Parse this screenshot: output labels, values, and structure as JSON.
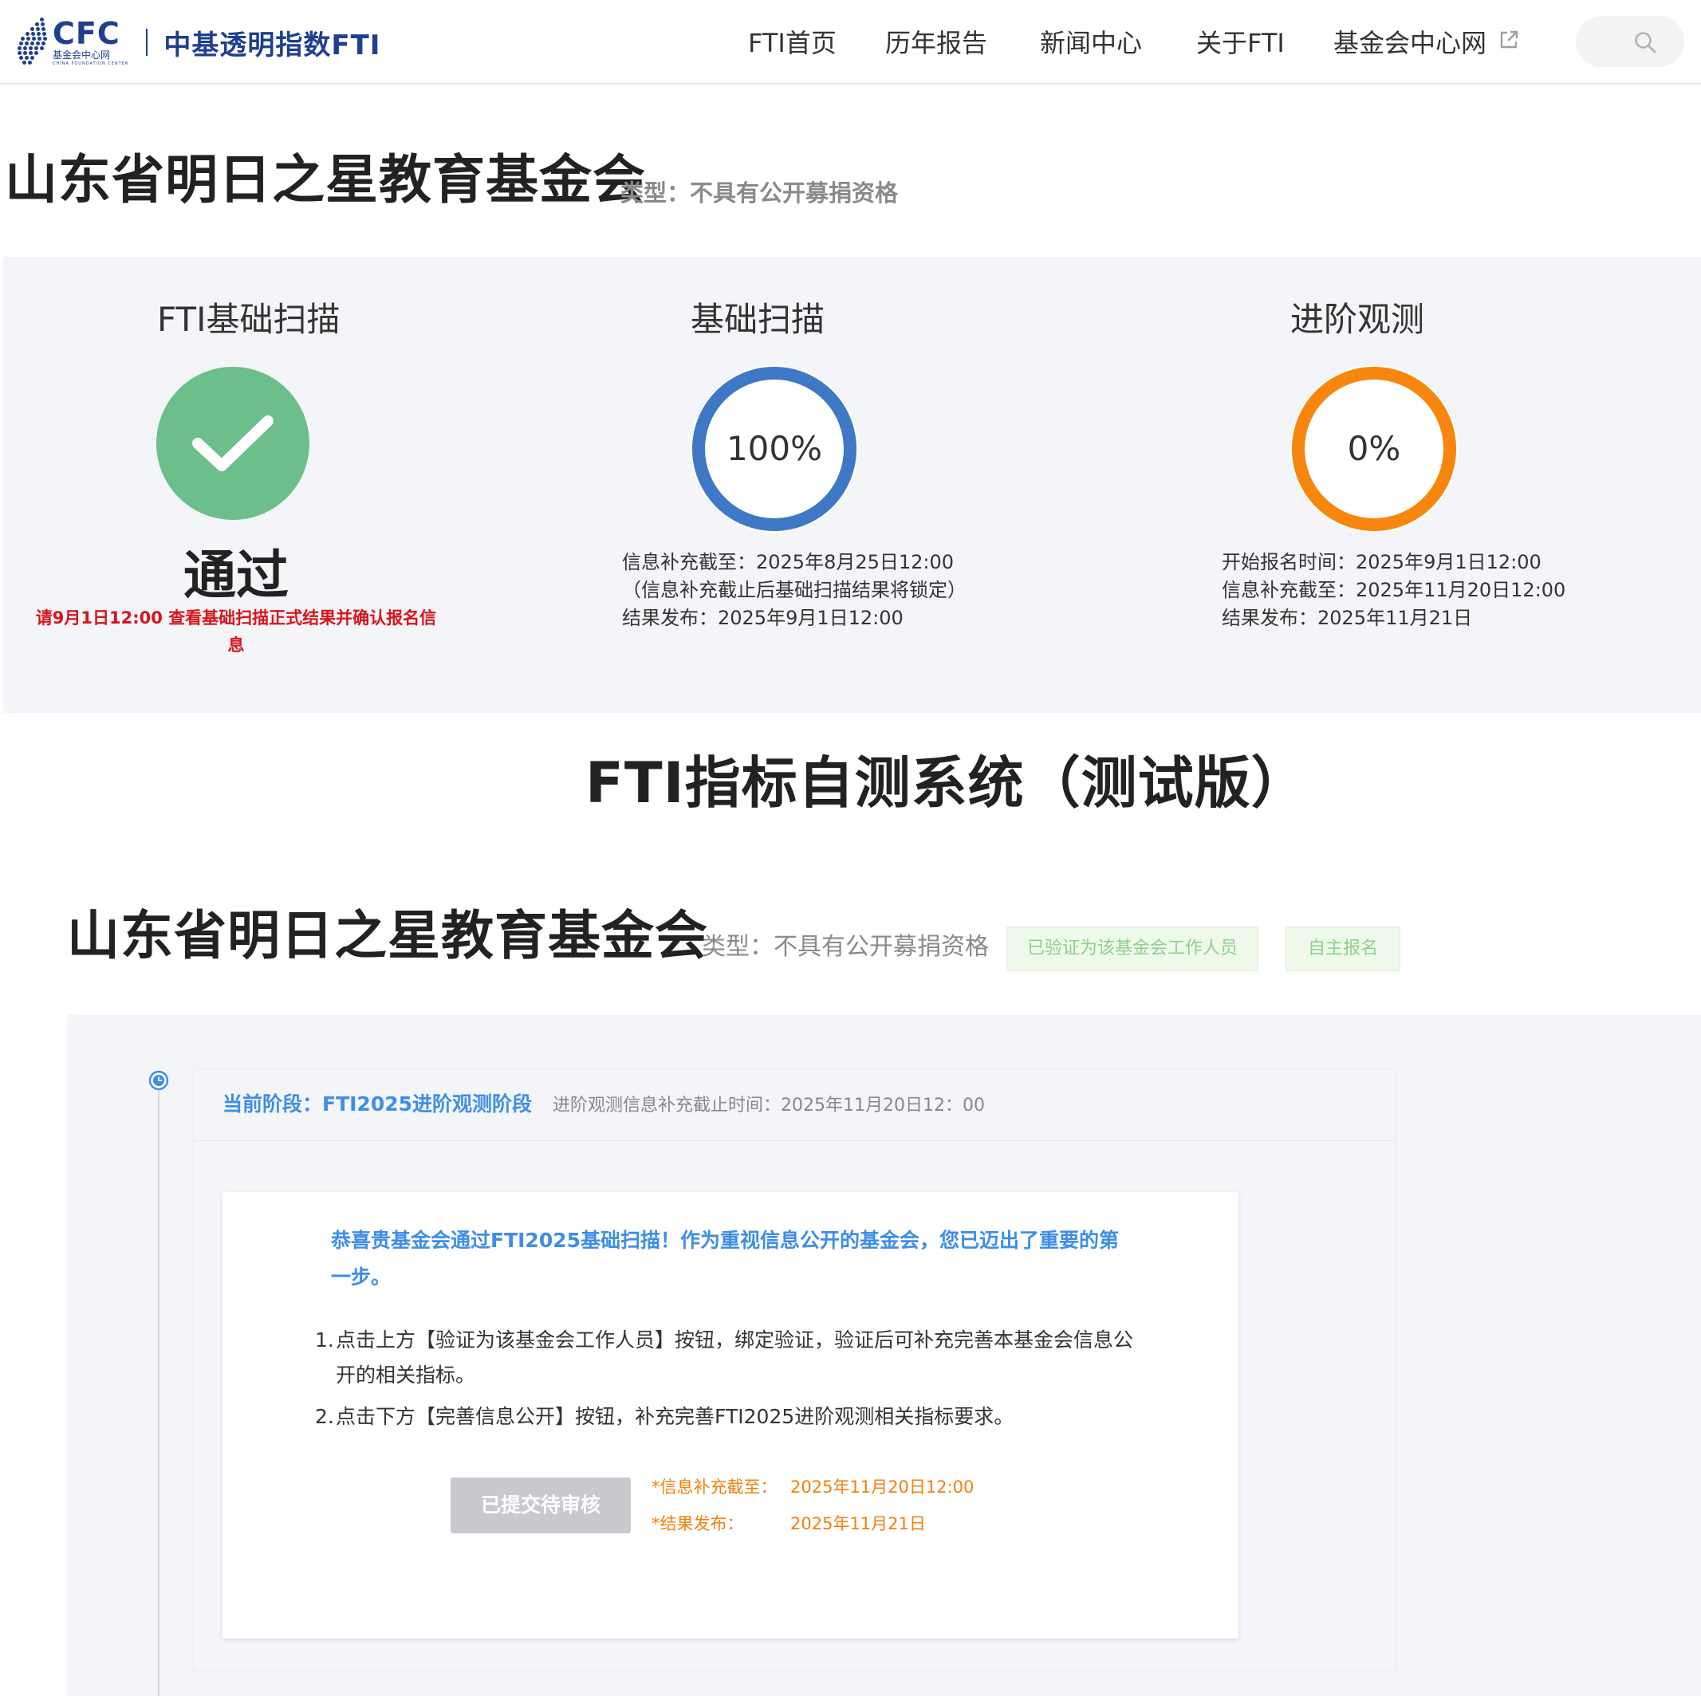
{
  "header": {
    "logo_cfc": "CFC",
    "logo_cfc_sub": "基金会中心网",
    "logo_cfc_sub2": "CHINA FOUNDATION CENTER",
    "logo_title": "中基透明指数FTI",
    "nav": [
      "FTI首页",
      "历年报告",
      "新闻中心",
      "关于FTI",
      "基金会中心网"
    ]
  },
  "page": {
    "title": "山东省明日之星教育基金会",
    "type": "类型：不具有公开募捐资格"
  },
  "scan": {
    "fti_basic": {
      "title": "FTI基础扫描",
      "status": "通过",
      "note": "请9月1日12:00 查看基础扫描正式结果并确认报名信息"
    },
    "basic": {
      "title": "基础扫描",
      "percent_label": "100%",
      "progress": 100,
      "lines": [
        "信息补充截至：2025年8月25日12:00",
        "（信息补充截止后基础扫描结果将锁定）",
        "结果发布：2025年9月1日12:00"
      ]
    },
    "advanced": {
      "title": "进阶观测",
      "percent_label": "0%",
      "progress": 0,
      "lines": [
        "开始报名时间：2025年9月1日12:00",
        "信息补充截至：2025年11月20日12:00",
        "结果发布：2025年11月21日"
      ]
    }
  },
  "system": {
    "title": "FTI指标自测系统（测试版）",
    "org_name": "山东省明日之星教育基金会",
    "org_type": "类型：不具有公开募捐资格",
    "tags": [
      "已验证为该基金会工作人员",
      "自主报名"
    ]
  },
  "stage": {
    "current": "当前阶段：FTI2025进阶观测阶段",
    "deadline": "进阶观测信息补充截止时间：2025年11月20日12：00",
    "congrats": "恭喜贵基金会通过FTI2025基础扫描！作为重视信息公开的基金会，您已迈出了重要的第一步。",
    "steps": [
      {
        "num": "1.",
        "text": "点击上方【验证为该基金会工作人员】按钮，绑定验证，验证后可补充完善本基金会信息公开的相关指标。"
      },
      {
        "num": "2.",
        "text": "点击下方【完善信息公开】按钮，补充完善FTI2025进阶观测相关指标要求。"
      }
    ],
    "button": "已提交待审核",
    "deadline_label": "*信息补充截至：",
    "deadline_value": "2025年11月20日12:00",
    "result_label": "*结果发布：",
    "result_value": "2025年11月21日"
  },
  "colors": {
    "brand": "#1f3f8f",
    "pass_green": "#6cbf8b",
    "basic_ring": "#3f78c4",
    "advanced_ring": "#f7860e",
    "alert_red": "#d8141b",
    "link_blue": "#3e8ee6",
    "orange_text": "#f47f0c"
  },
  "icons": {
    "external": "external-link-icon",
    "search": "search-icon",
    "check": "check-icon",
    "clock": "clock-icon"
  }
}
